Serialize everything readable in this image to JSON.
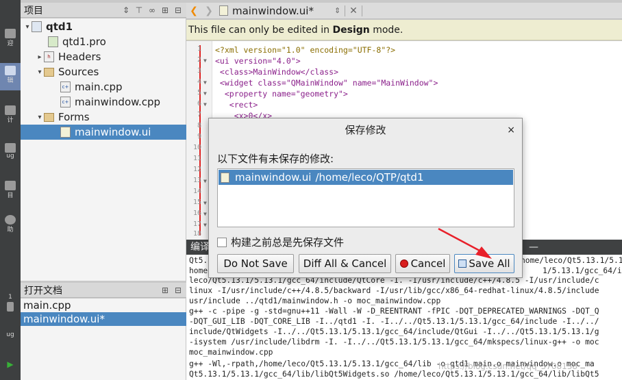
{
  "modebar": {
    "items": [
      {
        "icon": "welcome-icon",
        "label": "迎"
      },
      {
        "icon": "edit-icon",
        "label": "辑",
        "active": true
      },
      {
        "icon": "design-icon",
        "label": "计"
      },
      {
        "icon": "debug-icon",
        "label": "ug"
      },
      {
        "icon": "project-icon",
        "label": "目"
      },
      {
        "icon": "help-icon",
        "label": "助"
      },
      {
        "icon": "kit-icon",
        "label": "1"
      },
      {
        "icon": "debug-small-icon",
        "label": "ug"
      }
    ]
  },
  "project_panel": {
    "title": "项目",
    "tree": [
      {
        "label": "qtd1",
        "icon": "qt-project-icon",
        "expanded": true
      },
      {
        "label": "qtd1.pro",
        "icon": "pro-file-icon"
      },
      {
        "label": "Headers",
        "icon": "headers-folder-icon",
        "expanded": false
      },
      {
        "label": "Sources",
        "icon": "sources-folder-icon",
        "expanded": true
      },
      {
        "label": "main.cpp",
        "icon": "cpp-file-icon"
      },
      {
        "label": "mainwindow.cpp",
        "icon": "cpp-file-icon"
      },
      {
        "label": "Forms",
        "icon": "forms-folder-icon",
        "expanded": true
      },
      {
        "label": "mainwindow.ui",
        "icon": "ui-file-icon",
        "selected": true
      }
    ]
  },
  "open_docs": {
    "title": "打开文档",
    "items": [
      {
        "label": "main.cpp"
      },
      {
        "label": "mainwindow.ui*",
        "selected": true
      }
    ]
  },
  "editor": {
    "file_title": "mainwindow.ui*",
    "info": {
      "prefix": "This file can only be edited in ",
      "bold": "Design",
      "suffix": " mode."
    },
    "line_numbers": [
      "1",
      "2",
      "3",
      "4",
      "5",
      "6",
      "7",
      "8",
      "9",
      "10",
      "11",
      "12",
      "13",
      "14",
      "15",
      "16",
      "17",
      "18"
    ],
    "code_lines": [
      "<?xml version=\"1.0\" encoding=\"UTF-8\"?>",
      "<ui version=\"4.0\">",
      " <class>MainWindow</class>",
      " <widget class=\"QMainWindow\" name=\"MainWindow\">",
      "  <property name=\"geometry\">",
      "   <rect>",
      "    <x>0</x>"
    ]
  },
  "compile_output": {
    "title": "编译",
    "lines": [
      "Qt5.",
      "home",
      "leco/Qt5.13.1/5.13.1/gcc_64/include/QtCore -I. -I/usr/include/c++/4.8.5 -I/usr/include/c",
      "linux -I/usr/include/c++/4.8.5/backward -I/usr/lib/gcc/x86_64-redhat-linux/4.8.5/include",
      "usr/include ../qtd1/mainwindow.h -o moc_mainwindow.cpp",
      "g++ -c -pipe -g -std=gnu++11 -Wall -W -D_REENTRANT -fPIC -DQT_DEPRECATED_WARNINGS -DQT_Q",
      "-DQT_GUI_LIB -DQT_CORE_LIB -I../qtd1 -I. -I../../Qt5.13.1/5.13.1/gcc_64/include -I../../",
      "include/QtWidgets -I../../Qt5.13.1/5.13.1/gcc_64/include/QtGui -I../../Qt5.13.1/5.13.1/g",
      "-isystem /usr/include/libdrm -I. -I../../Qt5.13.1/5.13.1/gcc_64/mkspecs/linux-g++ -o moc",
      "moc_mainwindow.cpp",
      "g++ -Wl,-rpath,/home/leco/Qt5.13.1/5.13.1/gcc_64/lib -o qtd1 main.o mainwindow.o moc_ma",
      "Qt5.13.1/5.13.1/gcc_64/lib/libQt5Widgets.so /home/leco/Qt5.13.1/5.13.1/gcc_64/lib/libQt5"
    ],
    "right_fragments": [
      "home/leco/Qt5.13.1/5.1",
      "1/5.13.1/gcc_64/i"
    ]
  },
  "watermark": "https://blog.csdn.net/qq_3708138",
  "dialog": {
    "title": "保存修改",
    "close_glyph": "×",
    "label": "以下文件有未保存的修改:",
    "files": [
      {
        "name": "mainwindow.ui",
        "path": "/home/leco/QTP/qtd1",
        "selected": true
      }
    ],
    "checkbox_label": "构建之前总是先保存文件",
    "checkbox_checked": false,
    "buttons": {
      "do_not_save": "Do Not Save",
      "diff_all_cancel": "Diff All & Cancel",
      "cancel": "Cancel",
      "save_all": "Save All"
    }
  },
  "colors": {
    "selection": "#4a87c0",
    "info_bar": "#eeedd1",
    "annotation_arrow": "#e8202a",
    "nav_arrow": "#f08a00"
  }
}
